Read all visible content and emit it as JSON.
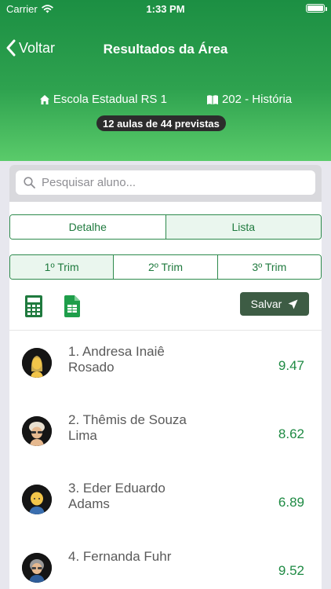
{
  "status": {
    "carrier": "Carrier",
    "time": "1:33 PM"
  },
  "nav": {
    "back_label": "Voltar",
    "title": "Resultados da Área"
  },
  "info": {
    "school": "Escola Estadual RS 1",
    "class": "202 - História",
    "lessons": "12 aulas de 44 previstas"
  },
  "search": {
    "placeholder": "Pesquisar aluno..."
  },
  "view_tabs": [
    {
      "label": "Detalhe",
      "active": false
    },
    {
      "label": "Lista",
      "active": true
    }
  ],
  "trim_tabs": [
    {
      "label": "1º Trim",
      "active": true
    },
    {
      "label": "2º Trim",
      "active": false
    },
    {
      "label": "3º Trim",
      "active": false
    }
  ],
  "toolbar": {
    "save_label": "Salvar",
    "calc_icon": "calculator-icon",
    "sheet_icon": "spreadsheet-icon"
  },
  "students": [
    {
      "name": "1. Andresa Inaiê Rosado",
      "grade": "9.47"
    },
    {
      "name": "2. Thêmis de Souza Lima",
      "grade": "8.62"
    },
    {
      "name": "3. Eder Eduardo Adams",
      "grade": "6.89"
    },
    {
      "name": "4. Fernanda Fuhr",
      "grade": "9.52"
    }
  ],
  "colors": {
    "header_top": "#1c8f43",
    "header_bottom": "#5acb6a",
    "accent": "#1e8a43",
    "save_button": "#3d5c44"
  }
}
